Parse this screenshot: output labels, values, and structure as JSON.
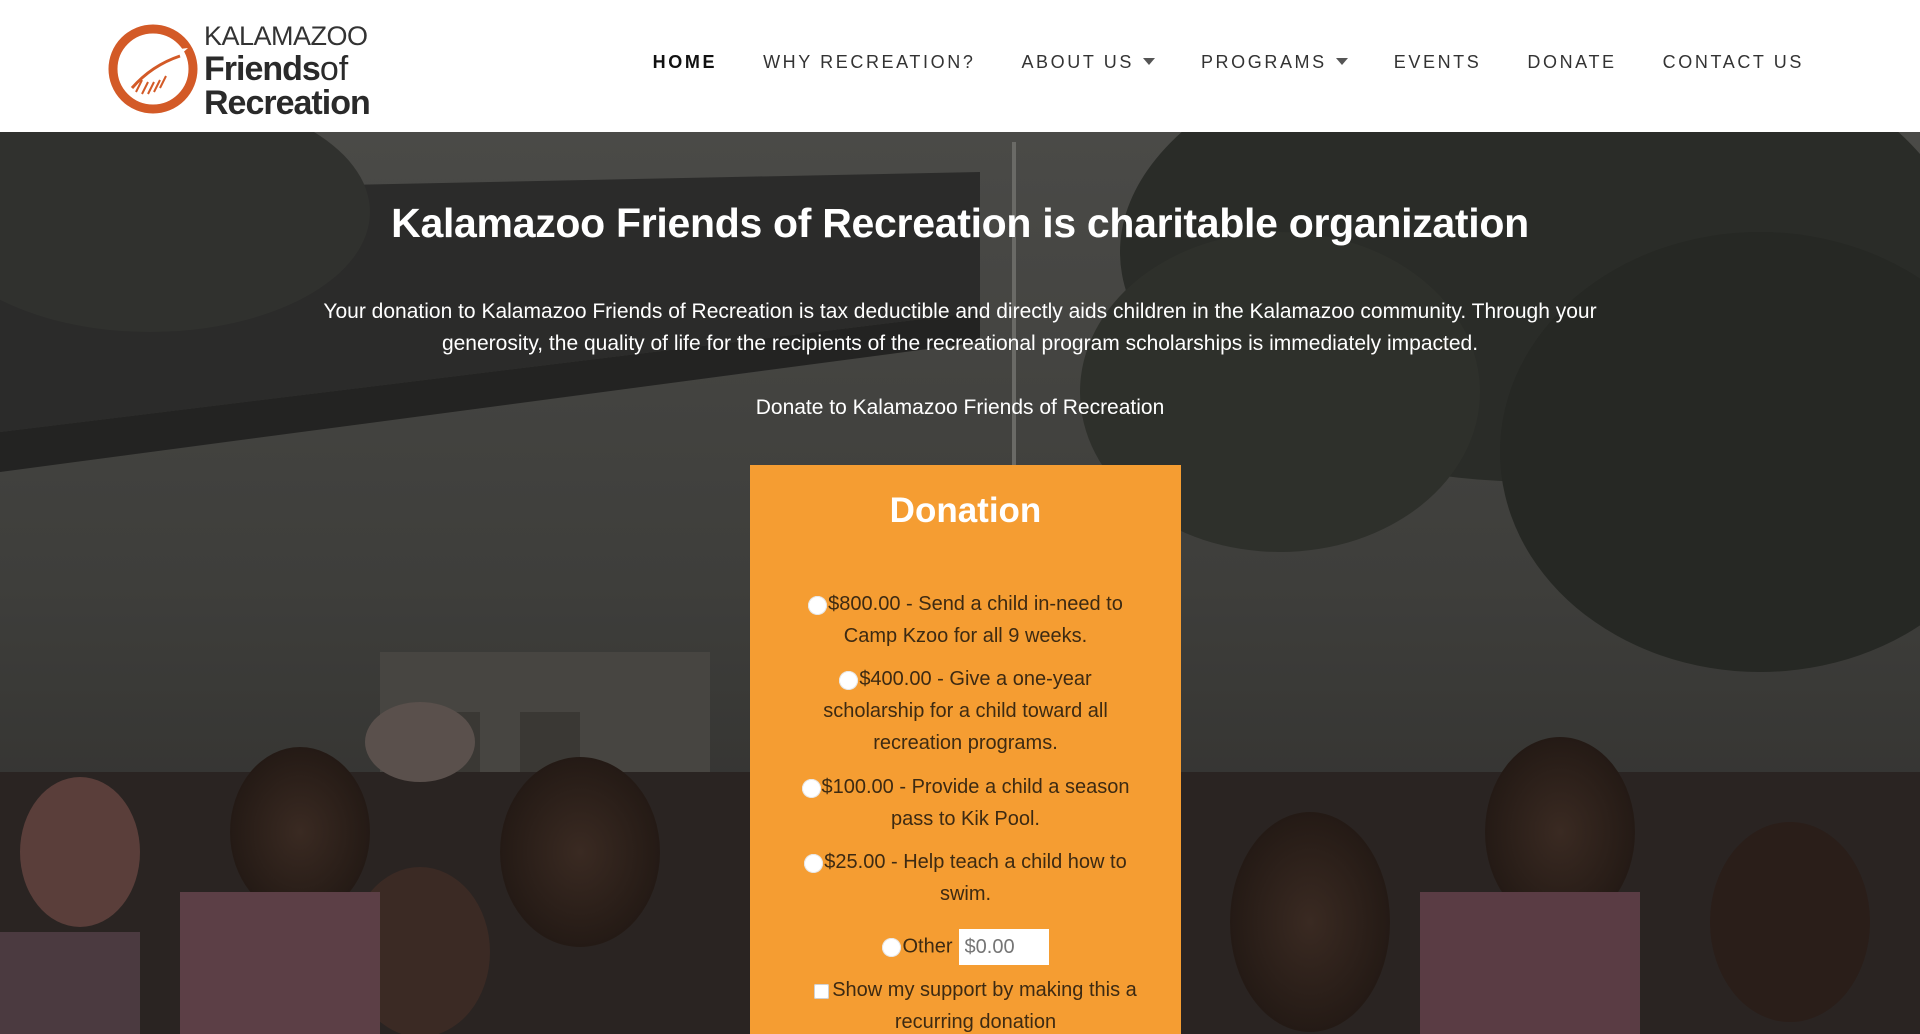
{
  "logo": {
    "line1": "KALAMAZOO",
    "line2": "Friends",
    "line2_suffix": "of",
    "line3": "Recreation",
    "mark_color": "#d35a27"
  },
  "nav": {
    "items": [
      {
        "label": "HOME",
        "active": true,
        "dropdown": false
      },
      {
        "label": "WHY RECREATION?",
        "active": false,
        "dropdown": false
      },
      {
        "label": "ABOUT US",
        "active": false,
        "dropdown": true
      },
      {
        "label": "PROGRAMS",
        "active": false,
        "dropdown": true
      },
      {
        "label": "EVENTS",
        "active": false,
        "dropdown": false
      },
      {
        "label": "DONATE",
        "active": false,
        "dropdown": false
      },
      {
        "label": "CONTACT US",
        "active": false,
        "dropdown": false
      }
    ]
  },
  "hero": {
    "title": "Kalamazoo Friends of Recreation is charitable organization",
    "paragraph": "Your donation to Kalamazoo Friends of Recreation is tax deductible and directly aids children in the Kalamazoo community. Through your generosity, the quality of life for the recipients of the recreational program scholarships is immediately impacted.",
    "donate_link": "Donate to Kalamazoo Friends of Recreation"
  },
  "donation": {
    "title": "Donation",
    "options": [
      {
        "label": "$800.00 - Send a child in-need to Camp Kzoo for all 9 weeks."
      },
      {
        "label": "$400.00 - Give a one-year scholarship for a child toward all recreation programs."
      },
      {
        "label": "$100.00 - Provide a child a season pass to Kik Pool."
      },
      {
        "label": "$25.00 - Help teach a child how to swim."
      }
    ],
    "other_label": "Other",
    "other_placeholder": "$0.00",
    "recurring_label": "Show my support by making this a recurring donation",
    "accent_color": "#f59d32"
  }
}
